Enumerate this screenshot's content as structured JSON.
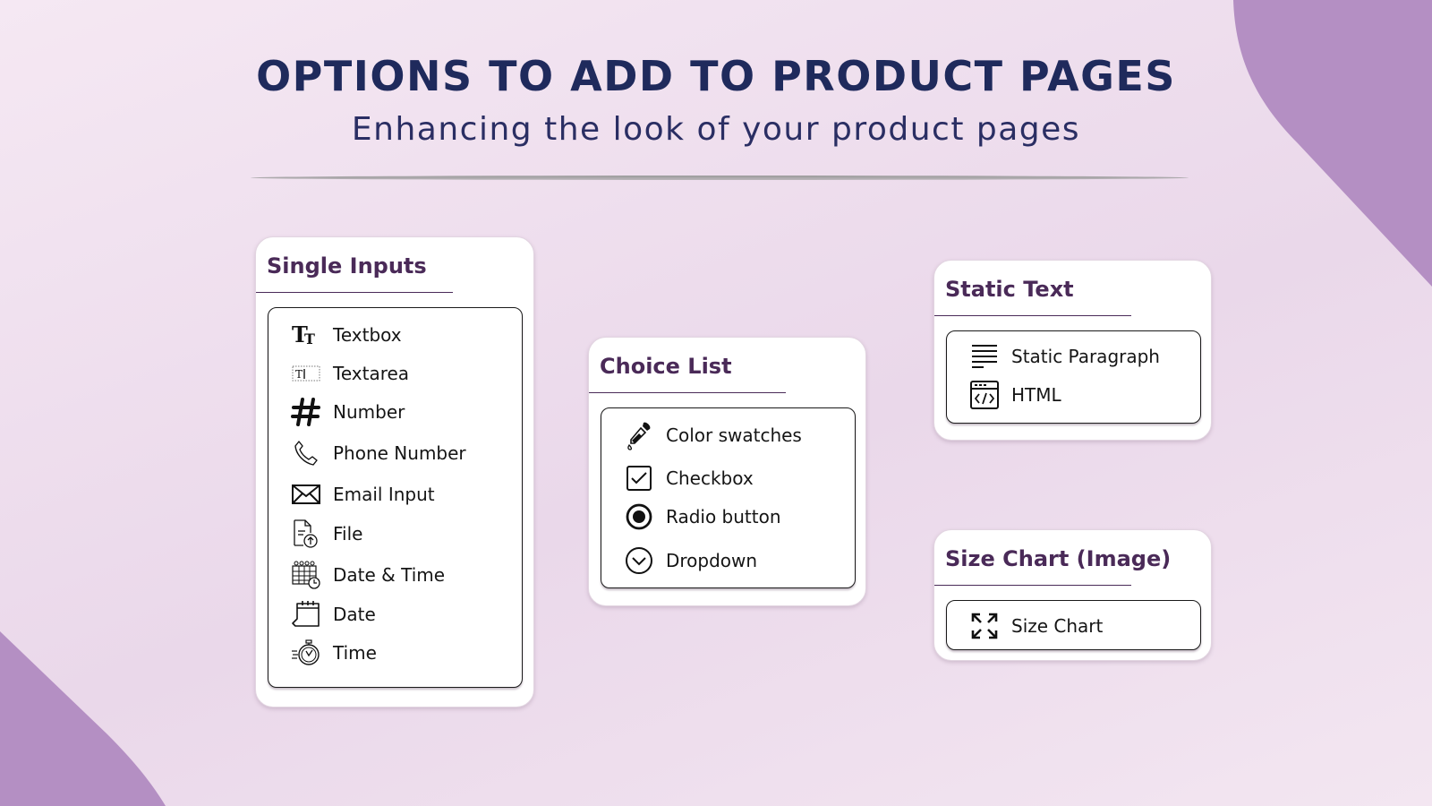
{
  "header": {
    "title": "OPTIONS TO ADD TO PRODUCT PAGES",
    "subtitle": "Enhancing the look of your product pages"
  },
  "colors": {
    "title": "#1f2a5c",
    "card_title": "#4a2a58",
    "blob": "#b48fc3",
    "background": "#f2e4f0"
  },
  "cards": {
    "single_inputs": {
      "title": "Single Inputs",
      "items": [
        {
          "label": "Textbox",
          "icon": "text-size-icon"
        },
        {
          "label": "Textarea",
          "icon": "textarea-icon"
        },
        {
          "label": "Number",
          "icon": "hash-icon"
        },
        {
          "label": "Phone Number",
          "icon": "phone-icon"
        },
        {
          "label": "Email Input",
          "icon": "envelope-icon"
        },
        {
          "label": "File",
          "icon": "file-upload-icon"
        },
        {
          "label": "Date & Time",
          "icon": "calendar-clock-icon"
        },
        {
          "label": "Date",
          "icon": "calendar-icon"
        },
        {
          "label": "Time",
          "icon": "stopwatch-icon"
        }
      ]
    },
    "choice_list": {
      "title": "Choice List",
      "items": [
        {
          "label": "Color swatches",
          "icon": "eyedropper-icon"
        },
        {
          "label": "Checkbox",
          "icon": "checkbox-icon"
        },
        {
          "label": "Radio button",
          "icon": "radio-icon"
        },
        {
          "label": "Dropdown",
          "icon": "chevron-circle-down-icon"
        }
      ]
    },
    "static_text": {
      "title": "Static Text",
      "items": [
        {
          "label": "Static Paragraph",
          "icon": "paragraph-lines-icon"
        },
        {
          "label": "HTML",
          "icon": "code-window-icon"
        }
      ]
    },
    "size_chart": {
      "title": "Size Chart (Image)",
      "items": [
        {
          "label": "Size Chart",
          "icon": "expand-arrows-icon"
        }
      ]
    }
  }
}
